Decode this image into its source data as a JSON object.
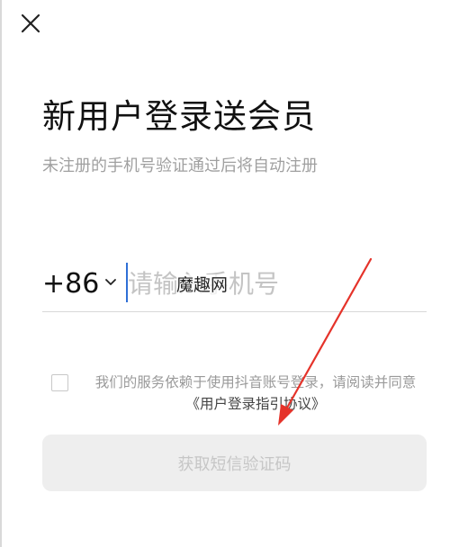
{
  "header": {
    "close_icon": "close-icon"
  },
  "main": {
    "title": "新用户登录送会员",
    "subtitle": "未注册的手机号验证通过后将自动注册"
  },
  "phone": {
    "country_code": "+86",
    "dropdown_icon": "chevron-down-icon",
    "placeholder": "请输入手机号",
    "value": "",
    "watermark_label": "魔趣网"
  },
  "agreement": {
    "checked": false,
    "text_before": "我们的服务依赖于使用抖音账号登录，请阅读并同意",
    "link_text": "《用户登录指引协议》"
  },
  "submit": {
    "label": "获取短信验证码",
    "enabled": false
  },
  "colors": {
    "accent_cursor": "#2f6fd6",
    "annotation_arrow": "#e5332a",
    "button_bg_disabled": "#eeeeee",
    "button_text_disabled": "#c6c6c6",
    "muted_text": "#a0a0a0"
  }
}
